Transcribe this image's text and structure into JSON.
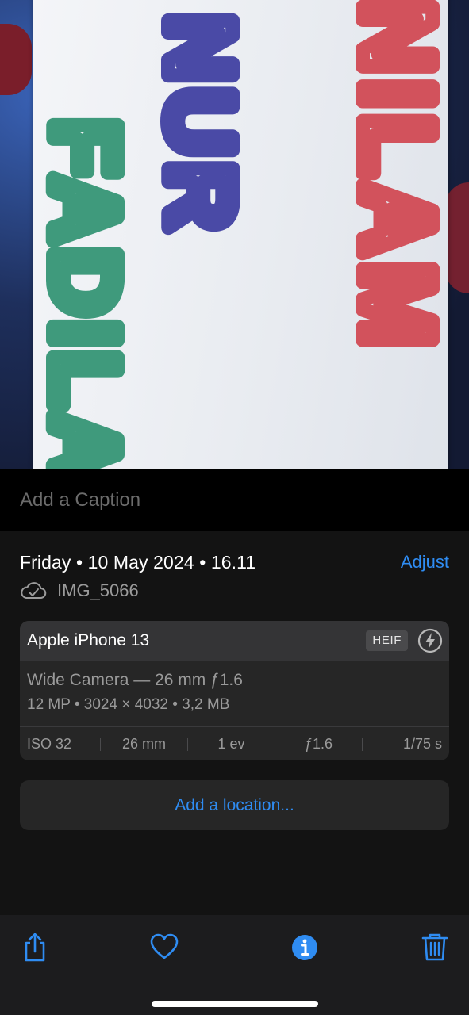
{
  "photo": {
    "words": [
      "NILAM",
      "NUR",
      "FADILAH"
    ]
  },
  "caption": {
    "placeholder": "Add a Caption"
  },
  "info": {
    "date_line": "Friday • 10 May 2024 • 16.11",
    "adjust_label": "Adjust",
    "file_name": "IMG_5066",
    "device": "Apple iPhone 13",
    "format_badge": "HEIF",
    "camera_line": "Wide Camera — 26 mm ƒ1.6",
    "specs_line": "12 MP  •  3024 × 4032  •  3,2 MB",
    "exif": {
      "iso": "ISO 32",
      "focal": "26 mm",
      "ev": "1 ev",
      "aperture": "ƒ1.6",
      "shutter": "1/75 s"
    },
    "location_label": "Add a location..."
  },
  "toolbar": {
    "icons": [
      "share-icon",
      "heart-icon",
      "info-icon",
      "trash-icon"
    ]
  },
  "colors": {
    "accent": "#2f8cf2",
    "background": "#131313",
    "card": "#262626",
    "card_header": "#343436",
    "toolbar": "#1c1c1e",
    "text_secondary": "#9a9a9a",
    "marker_green": "#3f9a7c",
    "marker_red": "#d2525c",
    "marker_purple": "#4a4aa6"
  }
}
